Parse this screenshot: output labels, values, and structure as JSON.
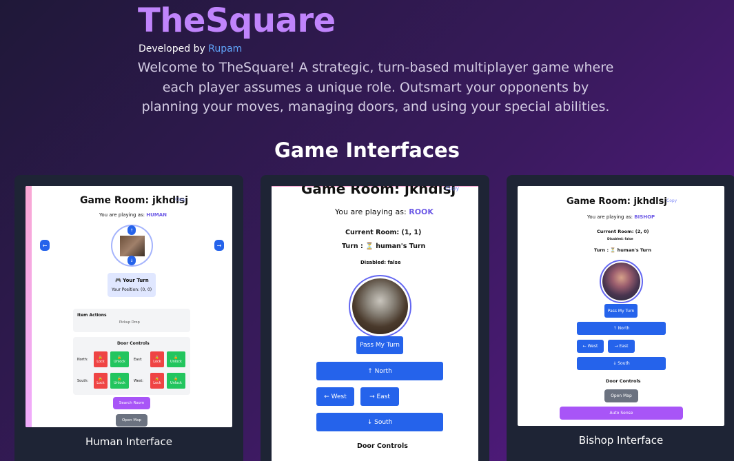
{
  "header": {
    "title": "TheSquare",
    "developed_by_prefix": "Developed by",
    "developer_name": "Rupam",
    "intro": "Welcome to TheSquare! A strategic, turn-based multiplayer game where each player assumes a unique role. Outsmart your opponents by planning your moves, managing doors, and using your special abilities."
  },
  "section": {
    "title": "Game Interfaces"
  },
  "cards": {
    "human": {
      "caption": "Human Interface",
      "room_title": "Game Room: jkhdlsj",
      "copy": "Copy",
      "playing_as_prefix": "You are playing as:",
      "role": "HUMAN",
      "left_arrow": "←",
      "right_arrow": "→",
      "up_arrow": "↑",
      "down_arrow": "↓",
      "your_turn": "🎮 Your Turn",
      "your_position": "Your Position: (0, 0)",
      "item_actions_title": "Item Actions",
      "item_actions_text": "Pickup   Drop",
      "door_controls_title": "Door Controls",
      "north": "North:",
      "east": "East:",
      "south": "South:",
      "west": "West:",
      "lock": "Lock",
      "unlock": "Unlock",
      "search_room": "Search Room",
      "open_map": "Open Map"
    },
    "rook": {
      "room_title": "Game Room: jkhdlsj",
      "copy": "Copy",
      "playing_as_prefix": "You are playing as:",
      "role": "ROOK",
      "current_room": "Current Room: (1, 1)",
      "turn": "Turn : ⏳ human's Turn",
      "disabled": "Disabled: false",
      "pass_turn": "Pass My Turn",
      "north": "↑ North",
      "west": "← West",
      "east": "→ East",
      "south": "↓ South",
      "door_controls": "Door Controls"
    },
    "bishop": {
      "caption": "Bishop Interface",
      "room_title": "Game Room: jkhdlsj",
      "copy": "Copy",
      "playing_as_prefix": "You are playing as:",
      "role": "BISHOP",
      "current_room": "Current Room: (2, 0)",
      "disabled": "Disabled: false",
      "turn": "Turn : ⏳ human's Turn",
      "pass_turn": "Pass My Turn",
      "north": "↑ North",
      "west": "← West",
      "east": "→ East",
      "south": "↓ South",
      "door_controls": "Door Controls",
      "open_map": "Open Map",
      "auto_sense": "Auto Sense"
    }
  }
}
